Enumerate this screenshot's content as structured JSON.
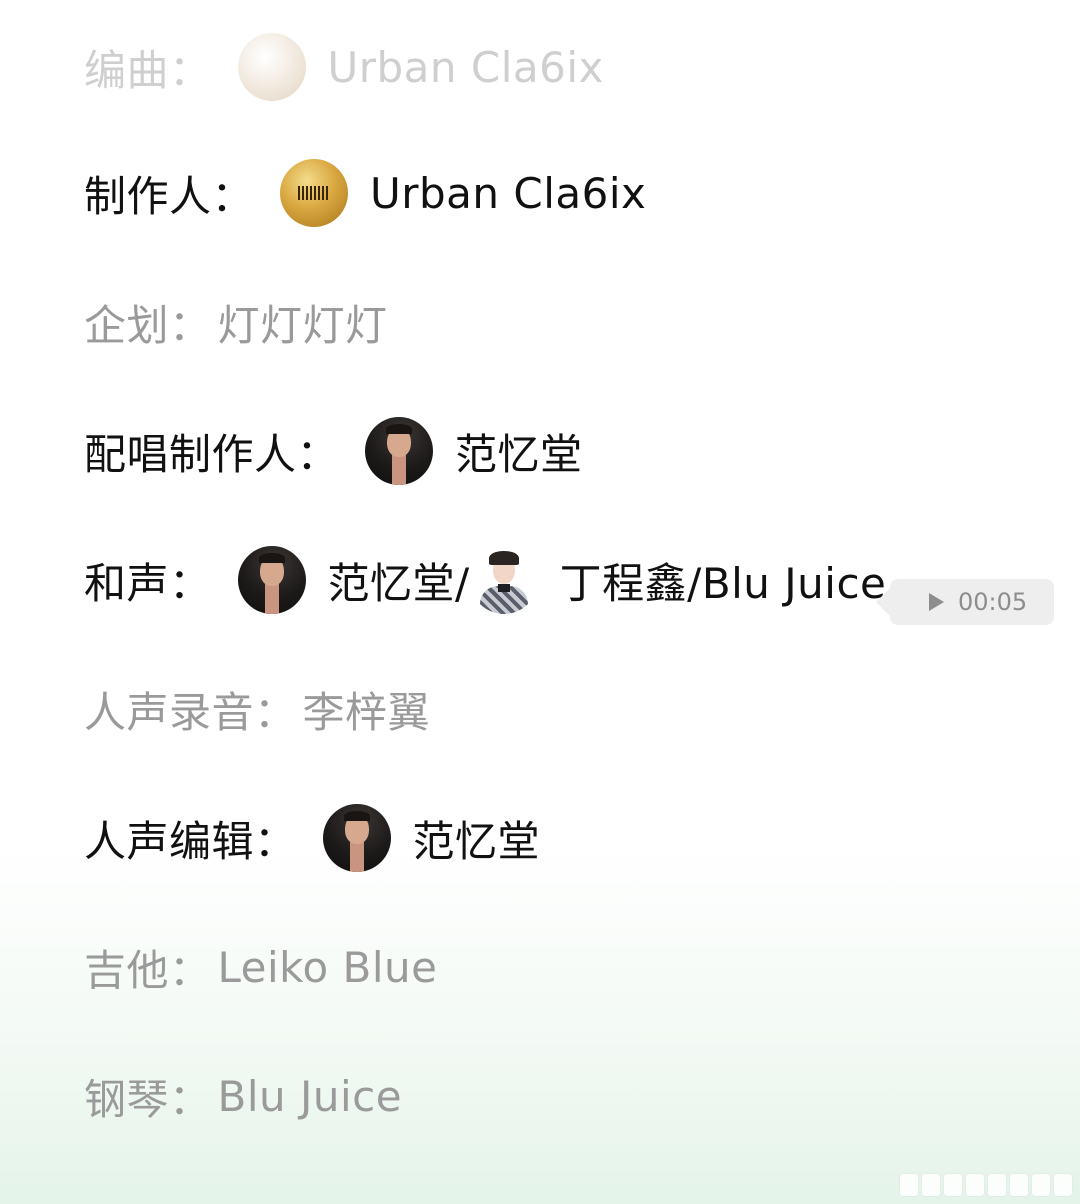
{
  "credits": [
    {
      "role": "编曲：",
      "name": "Urban Cla6ix",
      "avatar": "gold-logo-avatar",
      "style": "faded"
    },
    {
      "role": "制作人：",
      "name": "Urban Cla6ix",
      "avatar": "gold-logo-avatar",
      "style": "strong"
    },
    {
      "role": "企划：",
      "name": "灯灯灯灯",
      "style": "muted"
    },
    {
      "role": "配唱制作人：",
      "name": "范忆堂",
      "avatar": "dark-portrait-avatar",
      "style": "strong"
    },
    {
      "role": "和声：",
      "name_1": "范忆堂/",
      "name_2": "丁程鑫/Blu Juice",
      "style": "strong"
    },
    {
      "role": "人声录音：",
      "name": "李梓翼",
      "style": "muted"
    },
    {
      "role": "人声编辑：",
      "name": "范忆堂",
      "avatar": "dark-portrait-avatar",
      "style": "strong"
    },
    {
      "role": "吉他：",
      "name": "Leiko Blue",
      "style": "muted"
    },
    {
      "role": "钢琴：",
      "name": "Blu Juice",
      "style": "muted"
    }
  ],
  "voice_message": {
    "duration": "00:05",
    "icon": "play-icon"
  },
  "colors": {
    "strong_text": "#111111",
    "muted_text": "#9a9a9a",
    "faded_text": "#cfcfcf",
    "voice_bubble_bg": "#eeeeee",
    "bottom_glow": "#e2f3e8"
  }
}
